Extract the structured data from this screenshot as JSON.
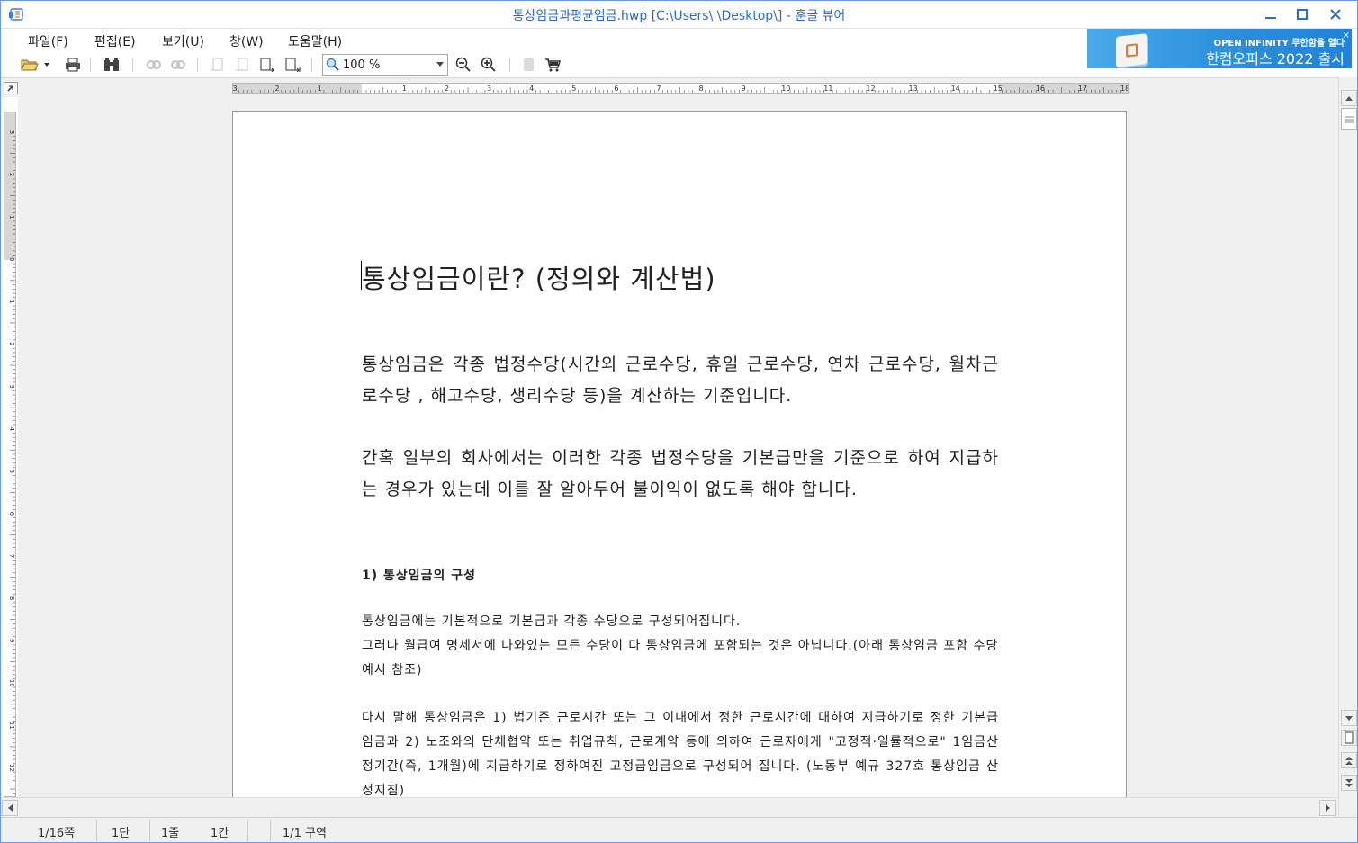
{
  "window": {
    "title": "통상임금과평균임금.hwp [C:\\Users\\         \\Desktop\\] - 훈글 뷰어",
    "minimize": "—",
    "maximize": "☐",
    "close": "✕"
  },
  "menu": [
    "파일(F)",
    "편집(E)",
    "보기(U)",
    "창(W)",
    "도움말(H)"
  ],
  "toolbar": {
    "zoom_value": "100 %",
    "icons": [
      "open-folder-icon",
      "print-icon",
      "find-icon",
      "previous-page-icon",
      "next-page-icon",
      "cart-icon"
    ]
  },
  "banner": {
    "line1": "OPEN INFINITY 무한함을 열다",
    "line2": "한컴오피스 2022 출시",
    "close": "×"
  },
  "ruler": {
    "h_labels": [
      "3",
      "2",
      "1",
      "",
      "1",
      "2",
      "3",
      "4",
      "5",
      "6",
      "7",
      "8",
      "9",
      "10",
      "11",
      "12",
      "13",
      "14",
      "15",
      "16",
      "17",
      "18"
    ],
    "v_labels": [
      "3",
      "2",
      "1",
      "0",
      "1",
      "2",
      "3",
      "4",
      "5",
      "6",
      "7",
      "8",
      "9",
      "10",
      "11",
      "12"
    ]
  },
  "document": {
    "title": "통상임금이란? (정의와 계산법)",
    "para1": "통상임금은 각종 법정수당(시간외 근로수당, 휴일 근로수당, 연차 근로수당, 월차근로수당 , 해고수당, 생리수당 등)을 계산하는 기준입니다.",
    "para2": "간혹 일부의 회사에서는 이러한 각종 법정수당을 기본급만을 기준으로 하여 지급하는 경우가 있는데 이를 잘 알아두어 불이익이 없도록 해야 합니다.",
    "heading1": "1) 통상임금의 구성",
    "para3_line1": "통상임금에는 기본적으로 기본급과 각종 수당으로 구성되어집니다.",
    "para3_line2": "그러나 월급여 명세서에 나와있는 모든 수당이 다 통상임금에 포함되는 것은 아닙니다.(아래 통상임금 포함 수당 예시 참조)",
    "para4": "다시 말해 통상임금은 1) 법기준 근로시간 또는 그 이내에서 정한 근로시간에 대하여 지급하기로 정한 기본급 임금과 2) 노조와의 단체협약 또는 취업규칙, 근로계약 등에 의하여 근로자에게 \"고정적·일률적으로\" 1임금산정기간(즉, 1개월)에 지급하기로 정하여진 고정급임금으로 구성되어 집니다. (노동부 예규 327호 통상임금 산정지침)"
  },
  "status": {
    "page": "1/16쪽",
    "column": "1단",
    "line": "1줄",
    "char": "1칸",
    "section": "1/1 구역"
  }
}
